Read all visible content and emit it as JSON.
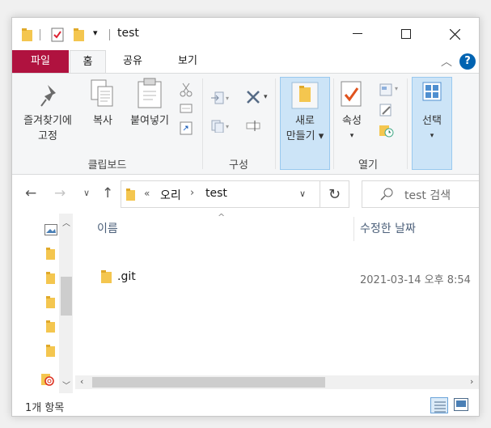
{
  "window": {
    "title": "test"
  },
  "titlebar": {
    "dropdown_glyph": "▾"
  },
  "ribbon_tabs": [
    "파일",
    "홈",
    "공유",
    "보기"
  ],
  "ribbon": {
    "clipboard": {
      "pin_label_line1": "즐겨찾기에",
      "pin_label_line2": "고정",
      "copy_label": "복사",
      "paste_label": "붙여넣기",
      "group_label": "클립보드"
    },
    "organize": {
      "group_label": "구성"
    },
    "new": {
      "new_folder_line1": "새로",
      "new_folder_line2": "만들기 ▾",
      "group_label": "새로 만들기"
    },
    "open": {
      "properties_label": "속성",
      "group_label": "열기"
    },
    "select": {
      "select_label": "선택"
    }
  },
  "address": {
    "overflow": "«",
    "crumbs": [
      "오리",
      "test"
    ],
    "search_placeholder": "test 검색"
  },
  "columns": {
    "name": "이름",
    "date": "수정한 날짜"
  },
  "files": [
    {
      "name": ".git",
      "modified": "2021-03-14 오후 8:54"
    }
  ],
  "status": {
    "item_count": "1개 항목"
  },
  "colors": {
    "file_tab": "#b0123f",
    "folder": "#f4c64f",
    "highlight": "#cce4f7",
    "accent": "#0063b1"
  }
}
